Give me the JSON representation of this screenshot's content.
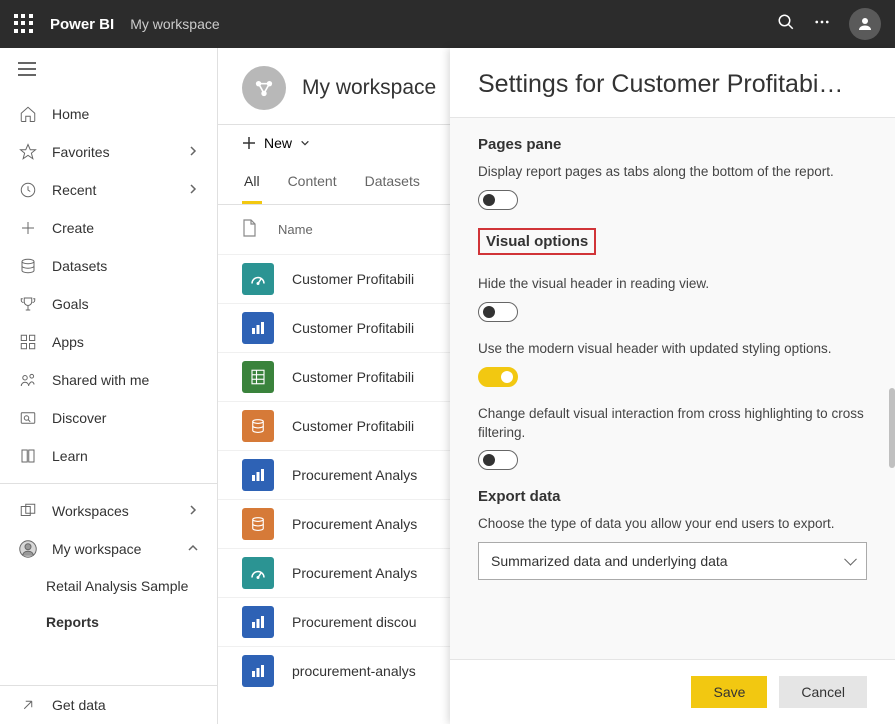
{
  "topbar": {
    "brand": "Power BI",
    "workspace": "My workspace"
  },
  "sidebar": {
    "items": [
      {
        "label": "Home"
      },
      {
        "label": "Favorites",
        "chevron": "right"
      },
      {
        "label": "Recent",
        "chevron": "right"
      },
      {
        "label": "Create"
      },
      {
        "label": "Datasets"
      },
      {
        "label": "Goals"
      },
      {
        "label": "Apps"
      },
      {
        "label": "Shared with me"
      },
      {
        "label": "Discover"
      },
      {
        "label": "Learn"
      }
    ],
    "workspaces_label": "Workspaces",
    "my_workspace_label": "My workspace",
    "sub_items": [
      {
        "label": "Retail Analysis Sample"
      },
      {
        "label": "Reports"
      }
    ],
    "get_data": "Get data"
  },
  "main": {
    "title": "My workspace",
    "new_label": "New",
    "tabs": [
      "All",
      "Content",
      "Datasets"
    ],
    "name_header": "Name",
    "rows": [
      {
        "icon": "gauge",
        "color": "teal",
        "label": "Customer Profitabili"
      },
      {
        "icon": "bar",
        "color": "blue",
        "label": "Customer Profitabili"
      },
      {
        "icon": "sheet",
        "color": "green",
        "label": "Customer Profitabili"
      },
      {
        "icon": "db",
        "color": "orange",
        "label": "Customer Profitabili"
      },
      {
        "icon": "bar",
        "color": "blue",
        "label": "Procurement Analys"
      },
      {
        "icon": "db",
        "color": "orange",
        "label": "Procurement Analys"
      },
      {
        "icon": "gauge",
        "color": "teal",
        "label": "Procurement Analys"
      },
      {
        "icon": "bar",
        "color": "blue",
        "label": "Procurement discou"
      },
      {
        "icon": "bar",
        "color": "blue",
        "label": "procurement-analys"
      }
    ]
  },
  "panel": {
    "title": "Settings for Customer Profitabi…",
    "sections": {
      "pages": {
        "title": "Pages pane",
        "desc": "Display report pages as tabs along the bottom of the report."
      },
      "visual": {
        "title": "Visual options",
        "hide_desc": "Hide the visual header in reading view.",
        "modern_desc": "Use the modern visual header with updated styling options.",
        "cross_desc": "Change default visual interaction from cross highlighting to cross filtering."
      },
      "export": {
        "title": "Export data",
        "desc": "Choose the type of data you allow your end users to export.",
        "selected": "Summarized data and underlying data"
      }
    },
    "save": "Save",
    "cancel": "Cancel"
  }
}
